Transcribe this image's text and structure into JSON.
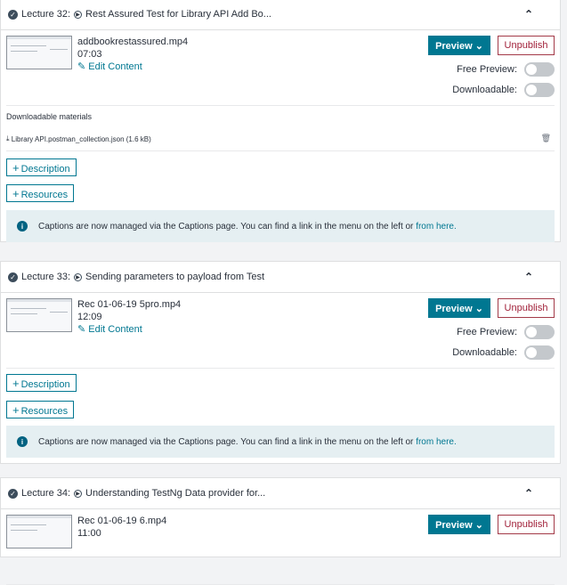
{
  "lectures": [
    {
      "number_label": "Lecture 32:",
      "title": "Rest Assured Test for Library API Add Bo...",
      "file_name": "addbookrestassured.mp4",
      "duration": "07:03",
      "edit_label": "Edit Content",
      "preview_label": "Preview",
      "unpublish_label": "Unpublish",
      "free_preview_label": "Free Preview:",
      "downloadable_label": "Downloadable:",
      "downloadable_materials_title": "Downloadable materials",
      "downloadable_file": "Library API.postman_collection.json (1.6 kB)",
      "description_label": "Description",
      "resources_label": "Resources",
      "caption_text": "Captions are now managed via the Captions page. You can find a link in the menu on the left or ",
      "caption_link": "from here."
    },
    {
      "number_label": "Lecture 33:",
      "title": "Sending parameters to payload from Test",
      "file_name": "Rec 01-06-19 5pro.mp4",
      "duration": "12:09",
      "edit_label": "Edit Content",
      "preview_label": "Preview",
      "unpublish_label": "Unpublish",
      "free_preview_label": "Free Preview:",
      "downloadable_label": "Downloadable:",
      "description_label": "Description",
      "resources_label": "Resources",
      "caption_text": "Captions are now managed via the Captions page. You can find a link in the menu on the left or ",
      "caption_link": "from here."
    },
    {
      "number_label": "Lecture 34:",
      "title": "Understanding TestNg Data provider for...",
      "file_name": "Rec 01-06-19 6.mp4",
      "duration": "11:00",
      "preview_label": "Preview",
      "unpublish_label": "Unpublish"
    }
  ],
  "colors": {
    "accent": "#007791",
    "unpublish": "#a1213a",
    "info_bg": "#e5eff2"
  }
}
